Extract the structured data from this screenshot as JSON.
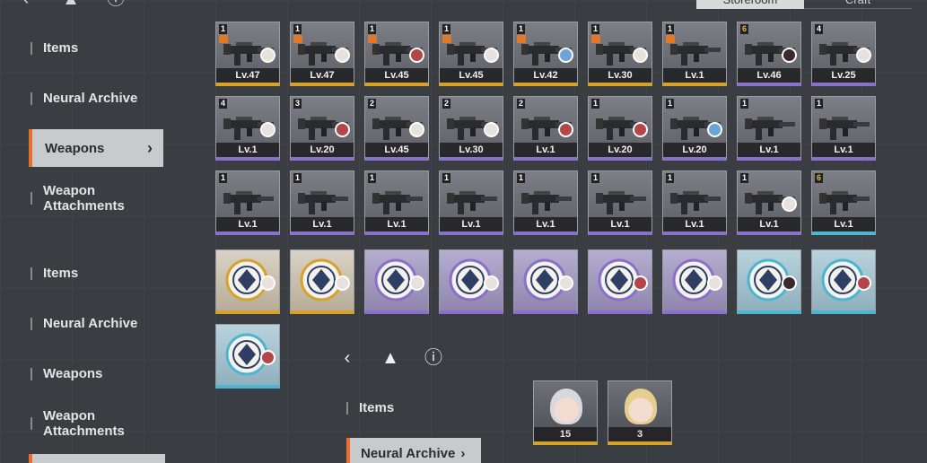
{
  "tabs": [
    "Storeroom",
    "Craft"
  ],
  "sidebar": [
    {
      "label": "Items"
    },
    {
      "label": "Neural Archive"
    },
    {
      "label": "Weapons",
      "active": true
    },
    {
      "label": "Weapon Attachments"
    },
    {
      "label": "Items"
    },
    {
      "label": "Neural Archive"
    },
    {
      "label": "Weapons"
    },
    {
      "label": "Weapon Attachments"
    }
  ],
  "weapons": [
    {
      "count": "1",
      "level": "Lv.47",
      "locked": true,
      "rarity": "gold",
      "avatar": "light"
    },
    {
      "count": "1",
      "level": "Lv.47",
      "locked": true,
      "rarity": "gold",
      "avatar": "light"
    },
    {
      "count": "1",
      "level": "Lv.45",
      "locked": true,
      "rarity": "gold",
      "avatar": "red"
    },
    {
      "count": "1",
      "level": "Lv.45",
      "locked": true,
      "rarity": "gold",
      "avatar": "light"
    },
    {
      "count": "1",
      "level": "Lv.42",
      "locked": true,
      "rarity": "gold",
      "avatar": "blue"
    },
    {
      "count": "1",
      "level": "Lv.30",
      "locked": true,
      "rarity": "gold",
      "avatar": "light"
    },
    {
      "count": "1",
      "level": "Lv.1",
      "locked": true,
      "rarity": "gold",
      "avatar": ""
    },
    {
      "count": "6",
      "level": "Lv.46",
      "locked": false,
      "rarity": "purple",
      "avatar": "dark",
      "goldnum": true
    },
    {
      "count": "4",
      "level": "Lv.25",
      "locked": false,
      "rarity": "purple",
      "avatar": "light"
    },
    {
      "count": "4",
      "level": "Lv.1",
      "locked": false,
      "rarity": "purple",
      "avatar": "light"
    },
    {
      "count": "3",
      "level": "Lv.20",
      "locked": false,
      "rarity": "purple",
      "avatar": "red"
    },
    {
      "count": "2",
      "level": "Lv.45",
      "locked": false,
      "rarity": "purple",
      "avatar": "light"
    },
    {
      "count": "2",
      "level": "Lv.30",
      "locked": false,
      "rarity": "purple",
      "avatar": "light"
    },
    {
      "count": "2",
      "level": "Lv.1",
      "locked": false,
      "rarity": "purple",
      "avatar": "red"
    },
    {
      "count": "1",
      "level": "Lv.20",
      "locked": false,
      "rarity": "purple",
      "avatar": "red"
    },
    {
      "count": "1",
      "level": "Lv.20",
      "locked": false,
      "rarity": "purple",
      "avatar": "blue"
    },
    {
      "count": "1",
      "level": "Lv.1",
      "locked": false,
      "rarity": "purple",
      "avatar": ""
    },
    {
      "count": "1",
      "level": "Lv.1",
      "locked": false,
      "rarity": "purple",
      "avatar": ""
    },
    {
      "count": "1",
      "level": "Lv.1",
      "locked": false,
      "rarity": "purple",
      "avatar": ""
    },
    {
      "count": "1",
      "level": "Lv.1",
      "locked": false,
      "rarity": "purple",
      "avatar": ""
    },
    {
      "count": "1",
      "level": "Lv.1",
      "locked": false,
      "rarity": "purple",
      "avatar": ""
    },
    {
      "count": "1",
      "level": "Lv.1",
      "locked": false,
      "rarity": "purple",
      "avatar": ""
    },
    {
      "count": "1",
      "level": "Lv.1",
      "locked": false,
      "rarity": "purple",
      "avatar": ""
    },
    {
      "count": "1",
      "level": "Lv.1",
      "locked": false,
      "rarity": "purple",
      "avatar": ""
    },
    {
      "count": "1",
      "level": "Lv.1",
      "locked": false,
      "rarity": "purple",
      "avatar": ""
    },
    {
      "count": "1",
      "level": "Lv.1",
      "locked": false,
      "rarity": "purple",
      "avatar": "light"
    },
    {
      "count": "6",
      "level": "Lv.1",
      "locked": false,
      "rarity": "blue",
      "avatar": "",
      "goldnum": true
    }
  ],
  "attachments": [
    {
      "rarity": "gold",
      "avatar": "light"
    },
    {
      "rarity": "gold",
      "avatar": "light"
    },
    {
      "rarity": "purple",
      "avatar": "light"
    },
    {
      "rarity": "purple",
      "avatar": "light"
    },
    {
      "rarity": "purple",
      "avatar": "light"
    },
    {
      "rarity": "purple",
      "avatar": "red"
    },
    {
      "rarity": "purple",
      "avatar": "light"
    },
    {
      "rarity": "blue",
      "avatar": "dark"
    },
    {
      "rarity": "blue",
      "avatar": "red"
    },
    {
      "rarity": "blue",
      "avatar": "red"
    }
  ],
  "overlay": {
    "items_label": "Items",
    "active_label": "Neural Archive"
  },
  "characters": [
    {
      "count": "15",
      "hair": "#d8d8dc"
    },
    {
      "count": "3",
      "hair": "#e6cf8e"
    }
  ],
  "colors": {
    "accent": "#e8702a",
    "gold": "#d7a22c",
    "purple": "#8a70c8",
    "blue": "#4cb5cf"
  }
}
